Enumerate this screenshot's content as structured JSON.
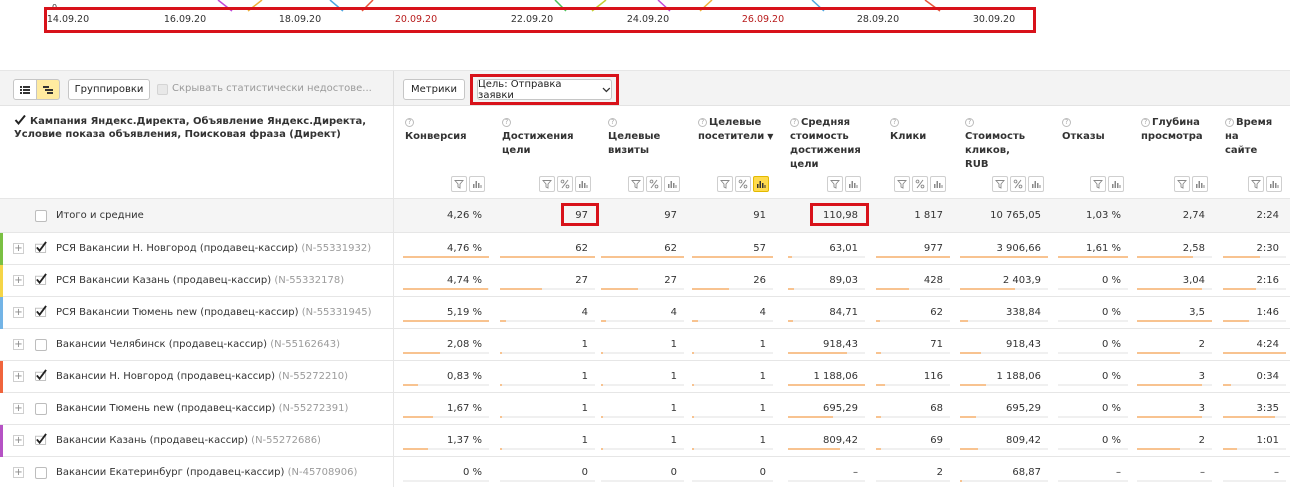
{
  "chart": {
    "zero_label": "0",
    "dates": [
      {
        "label": "14.09.20",
        "weekend": false
      },
      {
        "label": "16.09.20",
        "weekend": false
      },
      {
        "label": "18.09.20",
        "weekend": false
      },
      {
        "label": "20.09.20",
        "weekend": true
      },
      {
        "label": "22.09.20",
        "weekend": false
      },
      {
        "label": "24.09.20",
        "weekend": false
      },
      {
        "label": "26.09.20",
        "weekend": true
      },
      {
        "label": "28.09.20",
        "weekend": false
      },
      {
        "label": "30.09.20",
        "weekend": false
      }
    ],
    "line_colors": [
      "#c24bd8",
      "#f0b13b",
      "#4ea6e0",
      "#e8543a",
      "#4ac35a",
      "#c6cf36"
    ]
  },
  "toolbar": {
    "groupings_label": "Группировки",
    "hide_label": "Скрывать статистически недостове...",
    "metrics_label": "Метрики",
    "goal_label": "Цель: Отправка заявки"
  },
  "header": {
    "dimensions": "Кампания Яндекс.Директа, Объявление Яндекс.Директа, Условие показа объявления, Поисковая фраза (Директ)",
    "columns": [
      {
        "label": "Конверсия"
      },
      {
        "label": "Достижения цели"
      },
      {
        "label": "Целевые визиты"
      },
      {
        "label": "Целевые посетители",
        "sorted": "▼"
      },
      {
        "label": "Средняя стоимость достижения цели"
      },
      {
        "label": "Клики"
      },
      {
        "label": "Стоимость кликов, RUB"
      },
      {
        "label": "Отказы"
      },
      {
        "label": "Глубина просмотра"
      },
      {
        "label": "Время на сайте"
      }
    ]
  },
  "totals": {
    "label": "Итого и средние",
    "values": [
      "4,26 %",
      "97",
      "97",
      "91",
      "110,98",
      "1 817",
      "10 765,05",
      "1,03 %",
      "2,74",
      "2:24"
    ]
  },
  "rows": [
    {
      "name": "РСЯ Вакансии Н. Новгород (продавец-кассир)",
      "code": "(N-55331932)",
      "checked": true,
      "color": "#7ac043",
      "values": [
        "4,76 %",
        "62",
        "62",
        "57",
        "63,01",
        "977",
        "3 906,66",
        "1,61 %",
        "2,58",
        "2:30"
      ],
      "bars": [
        1.0,
        1.0,
        1.0,
        1.0,
        0.053,
        1.0,
        1.0,
        1.0,
        0.74,
        0.58
      ]
    },
    {
      "name": "РСЯ Вакансии Казань (продавец-кассир)",
      "code": "(N-55332178)",
      "checked": true,
      "color": "#f5d547",
      "values": [
        "4,74 %",
        "27",
        "27",
        "26",
        "89,03",
        "428",
        "2 403,9",
        "0 %",
        "3,04",
        "2:16"
      ],
      "bars": [
        0.99,
        0.44,
        0.44,
        0.46,
        0.075,
        0.44,
        0.62,
        0.0,
        0.87,
        0.52
      ]
    },
    {
      "name": "РСЯ Вакансии Тюмень new (продавец-кассир)",
      "code": "(N-55331945)",
      "checked": true,
      "color": "#73b4e6",
      "values": [
        "5,19 %",
        "4",
        "4",
        "4",
        "84,71",
        "62",
        "338,84",
        "0 %",
        "3,5",
        "1:46"
      ],
      "bars": [
        1.0,
        0.06,
        0.06,
        0.07,
        0.071,
        0.06,
        0.09,
        0.0,
        1.0,
        0.41
      ]
    },
    {
      "name": "Вакансии Челябинск (продавец-кассир)",
      "code": "(N-55162643)",
      "checked": false,
      "color": "",
      "values": [
        "2,08 %",
        "1",
        "1",
        "1",
        "918,43",
        "71",
        "918,43",
        "0 %",
        "2",
        "4:24"
      ],
      "bars": [
        0.43,
        0.02,
        0.02,
        0.02,
        0.77,
        0.07,
        0.24,
        0.0,
        0.57,
        1.0
      ]
    },
    {
      "name": "Вакансии Н. Новгород (продавец-кассир)",
      "code": "(N-55272210)",
      "checked": true,
      "color": "#f0643c",
      "values": [
        "0,83 %",
        "1",
        "1",
        "1",
        "1 188,06",
        "116",
        "1 188,06",
        "0 %",
        "3",
        "0:34"
      ],
      "bars": [
        0.17,
        0.02,
        0.02,
        0.02,
        1.0,
        0.12,
        0.3,
        0.0,
        0.86,
        0.13
      ]
    },
    {
      "name": "Вакансии Тюмень new (продавец-кассир)",
      "code": "(N-55272391)",
      "checked": false,
      "color": "",
      "values": [
        "1,67 %",
        "1",
        "1",
        "1",
        "695,29",
        "68",
        "695,29",
        "0 %",
        "3",
        "3:35"
      ],
      "bars": [
        0.35,
        0.02,
        0.02,
        0.02,
        0.59,
        0.07,
        0.18,
        0.0,
        0.86,
        0.82
      ]
    },
    {
      "name": "Вакансии Казань (продавец-кассир)",
      "code": "(N-55272686)",
      "checked": true,
      "color": "#b552c4",
      "values": [
        "1,37 %",
        "1",
        "1",
        "1",
        "809,42",
        "69",
        "809,42",
        "0 %",
        "2",
        "1:01"
      ],
      "bars": [
        0.29,
        0.02,
        0.02,
        0.02,
        0.68,
        0.07,
        0.21,
        0.0,
        0.57,
        0.23
      ]
    },
    {
      "name": "Вакансии Екатеринбург (продавец-кассир)",
      "code": "(N-45708906)",
      "checked": false,
      "color": "",
      "values": [
        "0 %",
        "0",
        "0",
        "0",
        "–",
        "2",
        "68,87",
        "–",
        "–",
        "–"
      ],
      "bars": [
        0.0,
        0.0,
        0.0,
        0.0,
        0.0,
        0.0,
        0.02,
        0.0,
        0.0,
        0.0
      ]
    }
  ]
}
